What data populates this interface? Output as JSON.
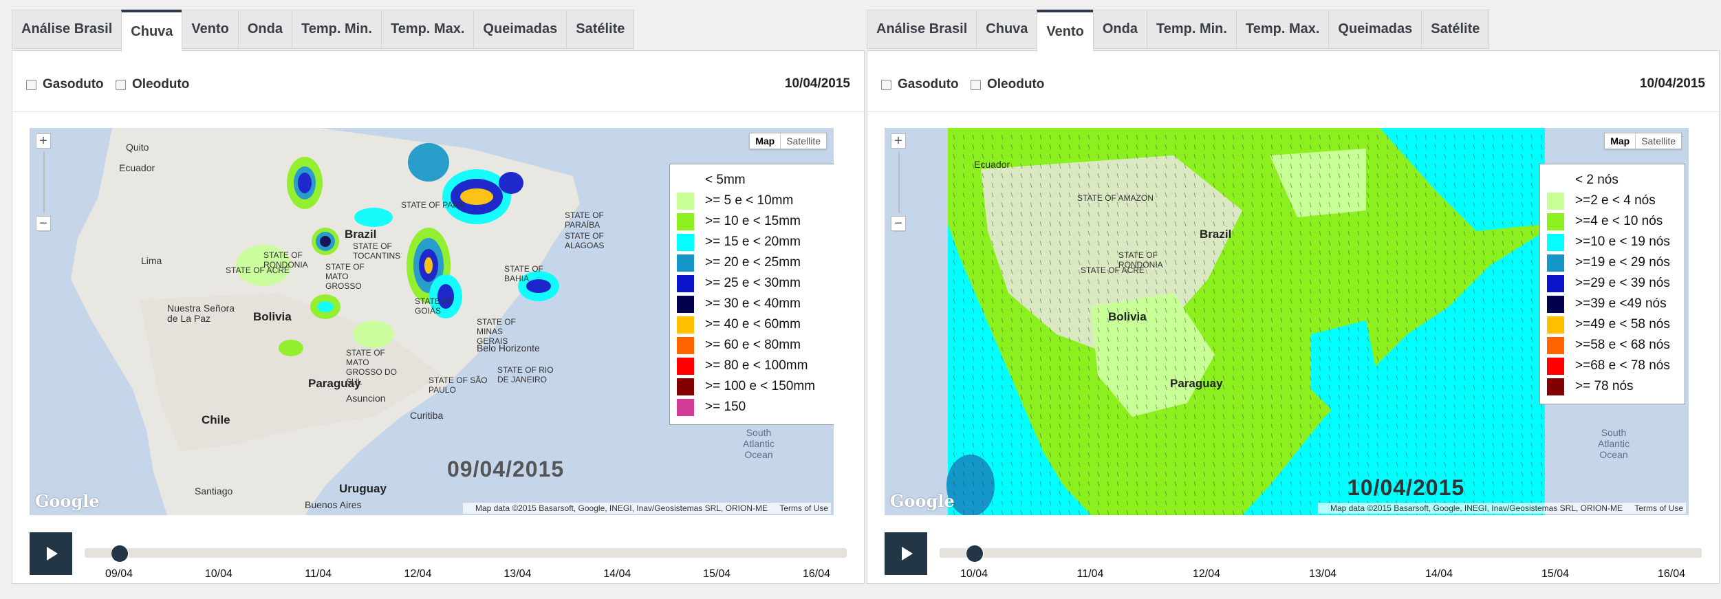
{
  "panels": [
    {
      "tabs": [
        "Análise Brasil",
        "Chuva",
        "Vento",
        "Onda",
        "Temp. Min.",
        "Temp. Max.",
        "Queimadas",
        "Satélite"
      ],
      "active_tab": "Chuva",
      "checkboxes": [
        "Gasoduto",
        "Oleoduto"
      ],
      "date": "10/04/2015",
      "map_type": [
        "Map",
        "Satellite"
      ],
      "overlay_date": "09/04/2015",
      "attribution": "Map data ©2015 Basarsoft, Google, INEGI, Inav/Geosistemas SRL, ORION-ME",
      "terms": "Terms of Use",
      "google": "Google",
      "places": [
        "Quito",
        "Ecuador",
        "Brazil",
        "Lima",
        "Bolivia",
        "Paraguay",
        "Chile",
        "Uruguay",
        "Santiago",
        "Buenos Aires",
        "Nuestra Señora de La Paz",
        "Belo Horizonte",
        "Curitiba",
        "Asuncion",
        "STATE OF ACRE",
        "STATE OF RONDONIA",
        "STATE OF MATO GROSSO",
        "STATE OF BAHIA",
        "STATE OF MINAS GERAIS",
        "STATE OF SÃO PAULO",
        "STATE OF MATO GROSSO DO SUL",
        "STATE OF GOIÁS",
        "STATE OF PARÁ",
        "STATE OF PARAÍBA",
        "STATE OF ALAGOAS",
        "STATE OF RIO DE JANEIRO",
        "STATE OF TOCANTINS",
        "South Atlantic Ocean"
      ],
      "legend": [
        {
          "label": "< 5mm",
          "color": "#ffffff"
        },
        {
          "label": ">= 5 e < 10mm",
          "color": "#c8ff96"
        },
        {
          "label": ">= 10 e < 15mm",
          "color": "#8cf01e"
        },
        {
          "label": ">= 15 e < 20mm",
          "color": "#00ffff"
        },
        {
          "label": ">= 20 e < 25mm",
          "color": "#1496c8"
        },
        {
          "label": ">= 25 e < 30mm",
          "color": "#0a14c8"
        },
        {
          "label": ">= 30 e < 40mm",
          "color": "#00004b"
        },
        {
          "label": ">= 40 e < 60mm",
          "color": "#ffbe00"
        },
        {
          "label": ">= 60 e < 80mm",
          "color": "#ff6400"
        },
        {
          "label": ">= 80 e < 100mm",
          "color": "#ff0000"
        },
        {
          "label": ">= 100 e < 150mm",
          "color": "#820000"
        },
        {
          "label": ">= 150",
          "color": "#d23c96"
        }
      ],
      "timeline": [
        "09/04",
        "10/04",
        "11/04",
        "12/04",
        "13/04",
        "14/04",
        "15/04",
        "16/04"
      ],
      "timeline_position": 0
    },
    {
      "tabs": [
        "Análise Brasil",
        "Chuva",
        "Vento",
        "Onda",
        "Temp. Min.",
        "Temp. Max.",
        "Queimadas",
        "Satélite"
      ],
      "active_tab": "Vento",
      "checkboxes": [
        "Gasoduto",
        "Oleoduto"
      ],
      "date": "10/04/2015",
      "map_type": [
        "Map",
        "Satellite"
      ],
      "overlay_date": "10/04/2015",
      "attribution": "Map data ©2015 Basarsoft, Google, INEGI, Inav/Geosistemas SRL, ORION-ME",
      "terms": "Terms of Use",
      "google": "Google",
      "places": [
        "Ecuador",
        "Brazil",
        "Bolivia",
        "Paraguay",
        "STATE OF ACRE",
        "STATE OF AMAZON",
        "STATE OF RONDONIA",
        "South Atlantic Ocean"
      ],
      "legend": [
        {
          "label": "< 2 nós",
          "color": "#ffffff"
        },
        {
          "label": ">=2 e < 4 nós",
          "color": "#c8ff96"
        },
        {
          "label": ">=4 e < 10 nós",
          "color": "#8cf01e"
        },
        {
          "label": ">=10 e < 19 nós",
          "color": "#00ffff"
        },
        {
          "label": ">=19 e < 29 nós",
          "color": "#1496c8"
        },
        {
          "label": ">=29 e < 39 nós",
          "color": "#0a14c8"
        },
        {
          "label": ">=39 e <49 nós",
          "color": "#00004b"
        },
        {
          "label": ">=49 e < 58 nós",
          "color": "#ffbe00"
        },
        {
          "label": ">=58 e < 68 nós",
          "color": "#ff6400"
        },
        {
          "label": ">=68 e < 78 nós",
          "color": "#ff0000"
        },
        {
          "label": ">= 78 nós",
          "color": "#820000"
        }
      ],
      "timeline": [
        "10/04",
        "11/04",
        "12/04",
        "13/04",
        "14/04",
        "15/04",
        "16/04"
      ],
      "timeline_position": 0
    }
  ]
}
